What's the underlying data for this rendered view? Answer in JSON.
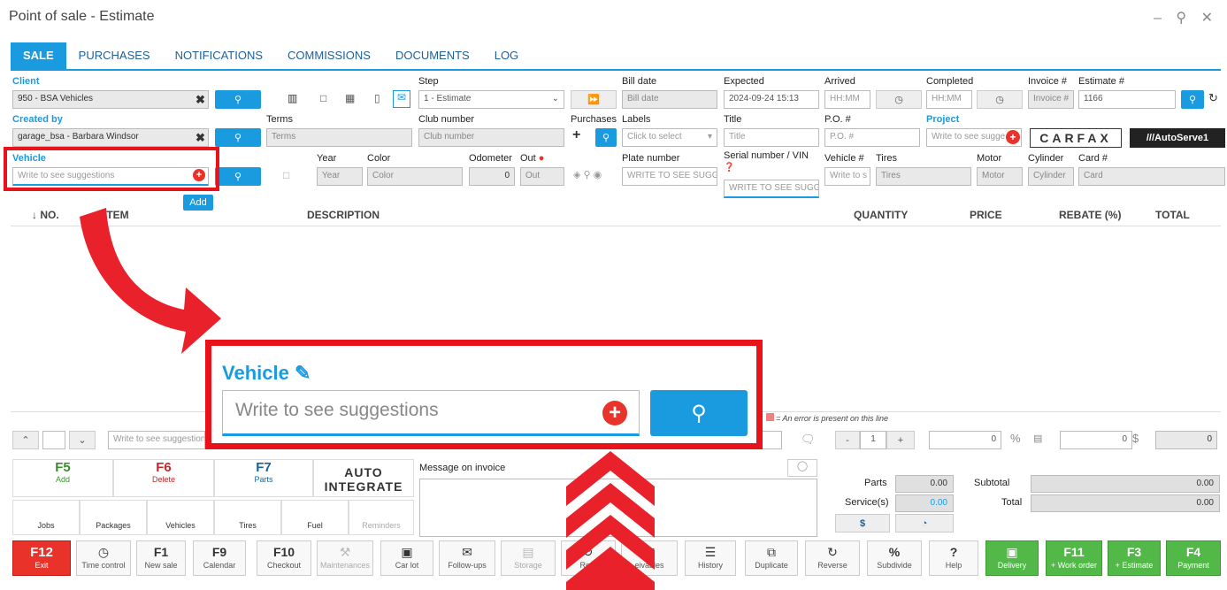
{
  "window": {
    "title": "Point of sale - Estimate",
    "controls": "– ⚲ ✕"
  },
  "tabs": [
    "SALE",
    "PURCHASES",
    "NOTIFICATIONS",
    "COMMISSIONS",
    "DOCUMENTS",
    "LOG"
  ],
  "row1": {
    "client_label": "Client",
    "client_value": "950 - BSA Vehicles",
    "step_label": "Step",
    "step_value": "1 - Estimate",
    "bill_date_label": "Bill date",
    "bill_date_ph": "Bill date",
    "expected_label": "Expected",
    "expected_value": "2024-09-24 15:13",
    "arrived_label": "Arrived",
    "arrived_ph": "HH:MM",
    "completed_label": "Completed",
    "completed_ph": "HH:MM",
    "invoice_label": "Invoice #",
    "invoice_ph": "Invoice #",
    "estimate_label": "Estimate #",
    "estimate_value": "1166"
  },
  "row2": {
    "created_label": "Created by",
    "created_value": "garage_bsa - Barbara Windsor",
    "terms_label": "Terms",
    "terms_ph": "Terms",
    "club_label": "Club number",
    "club_ph": "Club number",
    "purchases_label": "Purchases",
    "labels_label": "Labels",
    "labels_ph": "Click to select",
    "title_label": "Title",
    "title_ph": "Title",
    "po_label": "P.O. #",
    "po_ph": "P.O. #",
    "project_label": "Project",
    "project_ph": "Write to see sugge",
    "carfax": "CARFAX",
    "autoserve": "///AutoServe1"
  },
  "row3": {
    "vehicle_label": "Vehicle",
    "vehicle_ph": "Write to see suggestions",
    "add_label": "Add",
    "year_label": "Year",
    "year_ph": "Year",
    "color_label": "Color",
    "color_ph": "Color",
    "odometer_label": "Odometer",
    "odometer_value": "0",
    "out_label": "Out",
    "out_ph": "Out",
    "plate_label": "Plate number",
    "plate_ph": "WRITE TO SEE SUGGE",
    "serial_label": "Serial number / VIN",
    "serial_ph": "WRITE TO SEE SUGGE",
    "vehnum_label": "Vehicle #",
    "vehnum_ph": "Write to s",
    "tires_label": "Tires",
    "tires_ph": "Tires",
    "motor_label": "Motor",
    "motor_ph": "Motor",
    "cylinder_label": "Cylinder",
    "cylinder_ph": "Cylinder",
    "card_label": "Card #",
    "card_ph": "Card"
  },
  "table": {
    "headers": [
      "↓ NO.",
      "ITEM",
      "DESCRIPTION",
      "QUANTITY",
      "PRICE",
      "REBATE (%)",
      "TOTAL"
    ]
  },
  "zoom": {
    "label": "Vehicle",
    "placeholder": "Write to see suggestions"
  },
  "lineentry": {
    "ph": "Write to see suggestion",
    "error_note": "= An error is present on this line",
    "qty": "1",
    "price": "0",
    "rebate": "0",
    "total": "0"
  },
  "fkeys": [
    {
      "key": "F5",
      "sub": "Add"
    },
    {
      "key": "F6",
      "sub": "Delete"
    },
    {
      "key": "F7",
      "sub": "Parts"
    }
  ],
  "autointegrate": "AUTO INTEGRATE",
  "subkeys": [
    "Jobs",
    "Packages",
    "Vehicles",
    "Tires",
    "Fuel",
    "Reminders"
  ],
  "message_label": "Message on invoice",
  "totals": {
    "parts_label": "Parts",
    "parts": "0.00",
    "services_label": "Service(s)",
    "services": "0.00",
    "subtotal_label": "Subtotal",
    "subtotal": "0.00",
    "total_label": "Total",
    "total": "0.00"
  },
  "bottom": [
    {
      "k": "F12",
      "s": "Exit"
    },
    {
      "k": "",
      "s": "Time control"
    },
    {
      "k": "F1",
      "s": "New sale"
    },
    {
      "k": "F9",
      "s": "Calendar"
    },
    {
      "k": "F10",
      "s": "Checkout"
    },
    {
      "k": "",
      "s": "Maintenances"
    },
    {
      "k": "",
      "s": "Car lot"
    },
    {
      "k": "",
      "s": "Follow-ups"
    },
    {
      "k": "",
      "s": "Storage"
    },
    {
      "k": "",
      "s": "Retu"
    },
    {
      "k": "",
      "s": "eivables"
    },
    {
      "k": "",
      "s": "History"
    },
    {
      "k": "",
      "s": "Duplicate"
    },
    {
      "k": "",
      "s": "Reverse"
    },
    {
      "k": "",
      "s": "Subdivide"
    },
    {
      "k": "",
      "s": "Help"
    },
    {
      "k": "",
      "s": "Delivery"
    },
    {
      "k": "F11",
      "s": "+ Work order"
    },
    {
      "k": "F3",
      "s": "+ Estimate"
    },
    {
      "k": "F4",
      "s": "Payment"
    }
  ]
}
